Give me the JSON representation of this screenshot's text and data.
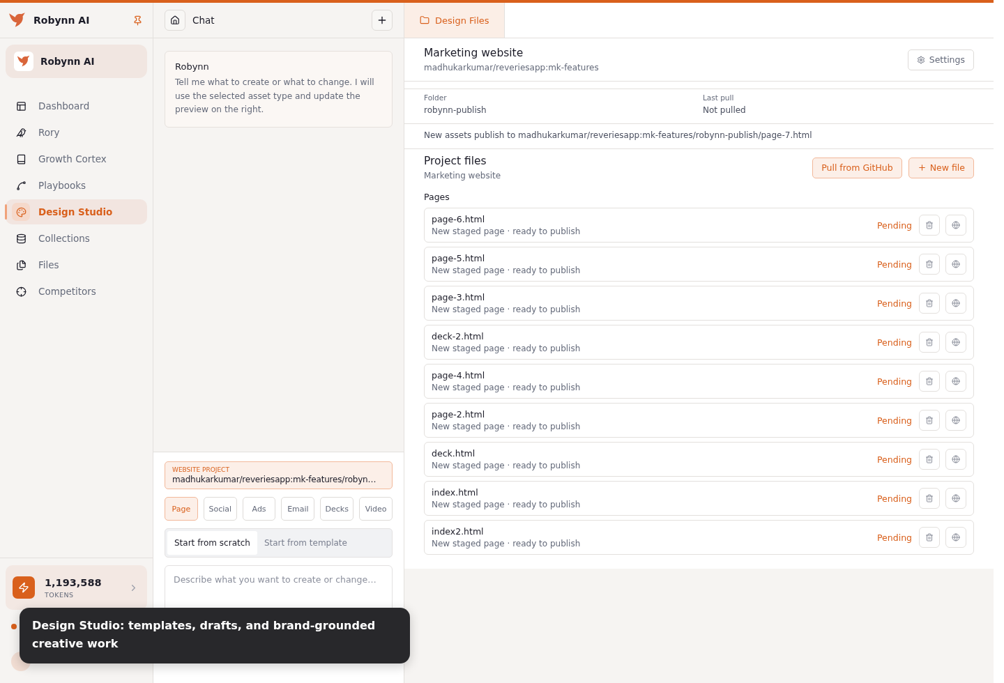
{
  "sidebar": {
    "brand": "Robynn AI",
    "workspace": "Robynn AI",
    "nav": [
      {
        "label": "Dashboard",
        "selected": false
      },
      {
        "label": "Rory",
        "selected": false
      },
      {
        "label": "Growth Cortex",
        "selected": false
      },
      {
        "label": "Playbooks",
        "selected": false
      },
      {
        "label": "Design Studio",
        "selected": true
      },
      {
        "label": "Collections",
        "selected": false
      },
      {
        "label": "Files",
        "selected": false
      },
      {
        "label": "Competitors",
        "selected": false
      }
    ],
    "tokens": {
      "count": "1,193,588",
      "label": "TOKENS"
    }
  },
  "chat": {
    "title": "Chat",
    "message": {
      "author": "Robynn",
      "text": "Tell me what to create or what to change. I will use the selected asset type and update the preview on the right."
    },
    "project": {
      "label": "WEBSITE PROJECT",
      "path": "madhukarkumar/reveriesapp:mk-features/robyn…"
    },
    "asset_types": [
      {
        "label": "Page",
        "selected": true
      },
      {
        "label": "Social",
        "selected": false
      },
      {
        "label": "Ads",
        "selected": false
      },
      {
        "label": "Email",
        "selected": false
      },
      {
        "label": "Decks",
        "selected": false
      },
      {
        "label": "Video",
        "selected": false
      }
    ],
    "modes": [
      {
        "label": "Start from scratch",
        "selected": true
      },
      {
        "label": "Start from template",
        "selected": false
      }
    ],
    "prompt": {
      "placeholder": "Describe what you want to create or change…"
    }
  },
  "tooltip": {
    "text": "Design Studio: templates, drafts, and brand-grounded creative work"
  },
  "files": {
    "tab": {
      "label": "Design Files",
      "selected": true
    },
    "project": {
      "title": "Marketing website",
      "repo": "madhukarkumar/reveriesapp:mk-features"
    },
    "settings_button": "Settings",
    "folder": {
      "label": "Folder",
      "value": "robynn-publish"
    },
    "last_pull": {
      "label": "Last pull",
      "value": "Not pulled"
    },
    "publish_note": "New assets publish to madhukarkumar/reveriesapp:mk-features/robynn-publish/page-7.html",
    "section": {
      "title": "Project files",
      "subtitle": "Marketing website"
    },
    "pull_button": "Pull from GitHub",
    "new_button": "New file",
    "pages_label": "Pages",
    "pages": [
      {
        "name": "page-6.html",
        "description": "New staged page · ready to publish",
        "status": "Pending"
      },
      {
        "name": "page-5.html",
        "description": "New staged page · ready to publish",
        "status": "Pending"
      },
      {
        "name": "page-3.html",
        "description": "New staged page · ready to publish",
        "status": "Pending"
      },
      {
        "name": "deck-2.html",
        "description": "New staged page · ready to publish",
        "status": "Pending"
      },
      {
        "name": "page-4.html",
        "description": "New staged page · ready to publish",
        "status": "Pending"
      },
      {
        "name": "page-2.html",
        "description": "New staged page · ready to publish",
        "status": "Pending"
      },
      {
        "name": "deck.html",
        "description": "New staged page · ready to publish",
        "status": "Pending"
      },
      {
        "name": "index.html",
        "description": "New staged page · ready to publish",
        "status": "Pending"
      },
      {
        "name": "index2.html",
        "description": "New staged page · ready to publish",
        "status": "Pending"
      }
    ]
  }
}
